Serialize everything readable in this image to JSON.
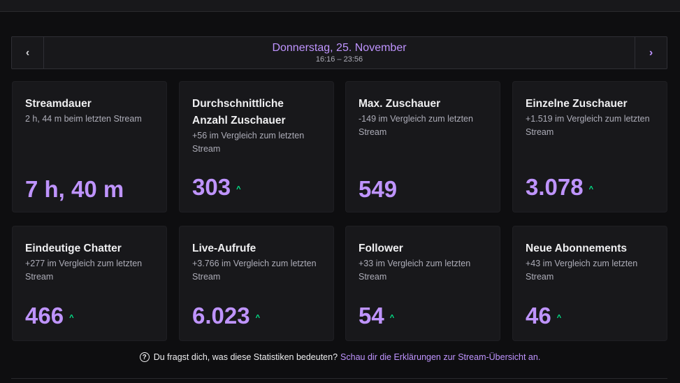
{
  "date_nav": {
    "prev_icon": "chevron-left-icon",
    "prev_glyph": "‹",
    "next_icon": "chevron-right-icon",
    "next_glyph": "›",
    "title": "Donnerstag, 25. November",
    "range": "16:16 – 23:56"
  },
  "stats": [
    {
      "title": "Streamdauer",
      "sub": "2 h, 44 m beim letzten Stream",
      "value": "7 h, 40 m",
      "trend": ""
    },
    {
      "title": "Durchschnittliche Anzahl Zuschauer",
      "sub": "+56 im Vergleich zum letzten Stream",
      "value": "303",
      "trend": "^"
    },
    {
      "title": "Max. Zuschauer",
      "sub": "-149 im Vergleich zum letzten Stream",
      "value": "549",
      "trend": ""
    },
    {
      "title": "Einzelne Zuschauer",
      "sub": "+1.519 im Vergleich zum letzten Stream",
      "value": "3.078",
      "trend": "^"
    },
    {
      "title": "Eindeutige Chatter",
      "sub": "+277 im Vergleich zum letzten Stream",
      "value": "466",
      "trend": "^"
    },
    {
      "title": "Live-Aufrufe",
      "sub": "+3.766 im Vergleich zum letzten Stream",
      "value": "6.023",
      "trend": "^"
    },
    {
      "title": "Follower",
      "sub": "+33 im Vergleich zum letzten Stream",
      "value": "54",
      "trend": "^"
    },
    {
      "title": "Neue Abonnements",
      "sub": "+43 im Vergleich zum letzten Stream",
      "value": "46",
      "trend": "^"
    }
  ],
  "footer": {
    "help_icon": "question-circle-icon",
    "help_glyph": "?",
    "text": "Du fragst dich, was diese Statistiken bedeuten?",
    "link": "Schau dir die Erklärungen zur Stream-Übersicht an."
  },
  "colors": {
    "accent": "#bf94ff",
    "trend_up": "#00f593",
    "card_bg": "#18181b",
    "page_bg": "#0e0e10"
  }
}
